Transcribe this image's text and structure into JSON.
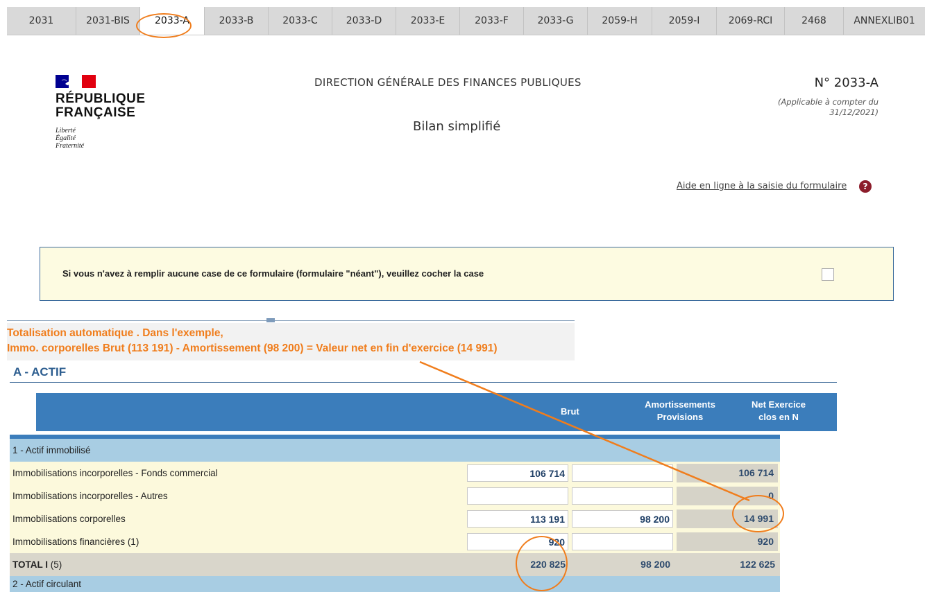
{
  "tabs": [
    "2031",
    "2031-BIS",
    "2033-A",
    "2033-B",
    "2033-C",
    "2033-D",
    "2033-E",
    "2033-F",
    "2033-G",
    "2059-H",
    "2059-I",
    "2069-RCI",
    "2468",
    "ANNEXLIB01"
  ],
  "active_tab": "2033-A",
  "header": {
    "republic_name_line1": "RÉPUBLIQUE",
    "republic_name_line2": "FRANÇAISE",
    "motto": [
      "Liberté",
      "Égalité",
      "Fraternité"
    ],
    "direction": "DIRECTION GÉNÉRALE DES FINANCES PUBLIQUES",
    "form_title": "Bilan simplifié",
    "form_number": "N° 2033-A",
    "applicable_line1": "(Applicable à compter du",
    "applicable_line2": "31/12/2021)",
    "help_link": "Aide en ligne à la saisie du formulaire",
    "help_icon": "?"
  },
  "neant": {
    "text": "Si vous n'avez à remplir aucune case de ce formulaire (formulaire \"néant\"), veuillez cocher la case",
    "checked": false
  },
  "annotation": {
    "line1": "Totalisation automatique .  Dans l'exemple,",
    "line2": "Immo. corporelles Brut (113 191)  -  Amortissement (98 200) = Valeur net en fin d'exercice (14 991)"
  },
  "section_title": "A - ACTIF",
  "columns": {
    "brut": "Brut",
    "amort_line1": "Amortissements",
    "amort_line2": "Provisions",
    "net_line1": "Net Exercice",
    "net_line2": "clos en N"
  },
  "rows": [
    {
      "kind": "cat",
      "label": "1 - Actif immobilisé"
    },
    {
      "kind": "item",
      "label": "Immobilisations incorporelles - Fonds commercial",
      "brut": "106 714",
      "amort": "",
      "net": "106 714"
    },
    {
      "kind": "item",
      "label": "Immobilisations incorporelles - Autres",
      "brut": "",
      "amort": "",
      "net": "0"
    },
    {
      "kind": "item",
      "label": "Immobilisations corporelles",
      "brut": "113 191",
      "amort": "98 200",
      "net": "14 991"
    },
    {
      "kind": "item",
      "label": "Immobilisations financières (1)",
      "brut": "920",
      "amort": "",
      "net": "920"
    },
    {
      "kind": "total",
      "label_bold": "TOTAL I",
      "label_rest": " (5)",
      "brut": "220 825",
      "amort": "98 200",
      "net": "122 625"
    },
    {
      "kind": "cat",
      "label": "2 - Actif circulant"
    }
  ],
  "colors": {
    "accent_orange": "#f07d1c",
    "header_blue": "#3b7dbb",
    "category_blue": "#a8cde3",
    "row_yellow": "#fcf9dc",
    "help_red": "#8c1d2b"
  }
}
